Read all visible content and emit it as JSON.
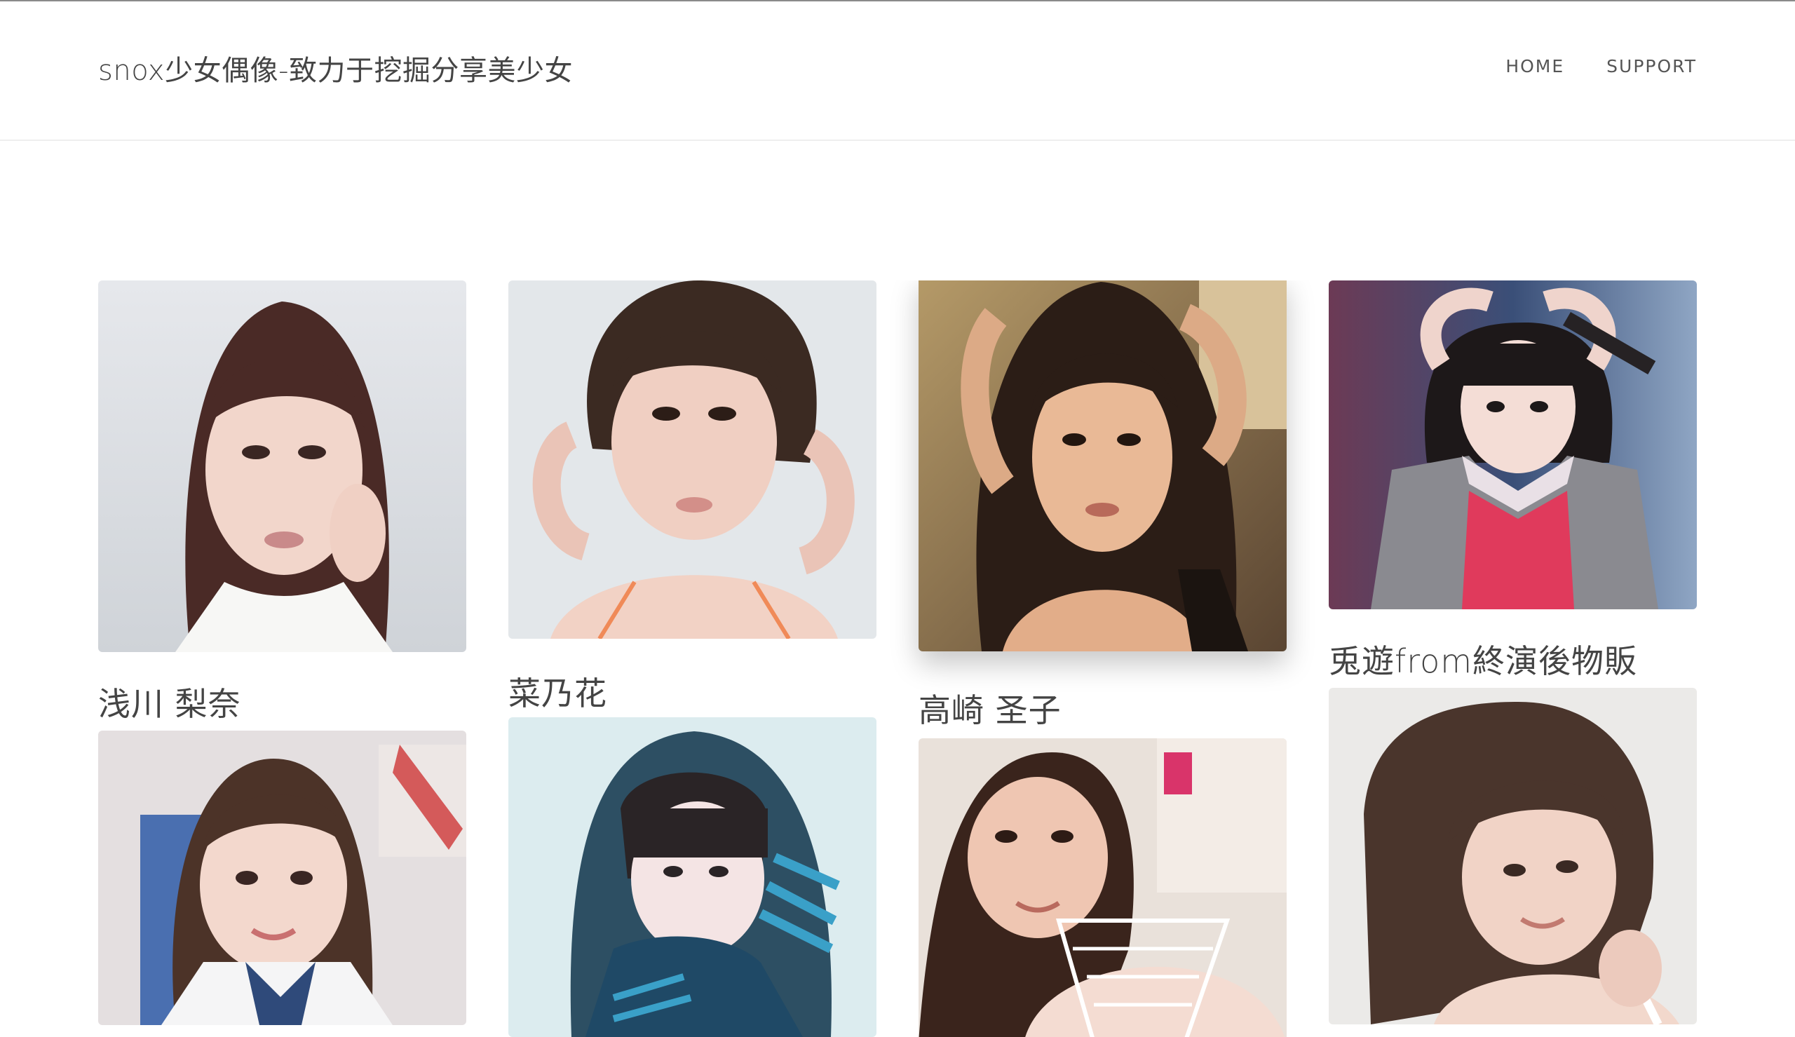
{
  "site": {
    "title": "snox少女偶像-致力于挖掘分享美少女",
    "nav": [
      "HOME",
      "SUPPORT"
    ]
  },
  "gallery": [
    {
      "caption": "浅川 梨奈",
      "icon": "portrait-photo"
    },
    {
      "caption": "菜乃花",
      "icon": "portrait-photo"
    },
    {
      "caption": "高崎 圣子",
      "icon": "portrait-photo"
    },
    {
      "caption": "兎遊from終演後物販",
      "icon": "portrait-photo"
    },
    {
      "caption": "",
      "icon": "portrait-photo"
    },
    {
      "caption": "",
      "icon": "portrait-photo"
    },
    {
      "caption": "",
      "icon": "portrait-photo"
    },
    {
      "caption": "",
      "icon": "portrait-photo"
    }
  ],
  "colors": {
    "text": "#444444",
    "nav_text": "#555555",
    "divider": "#eeeeee"
  }
}
